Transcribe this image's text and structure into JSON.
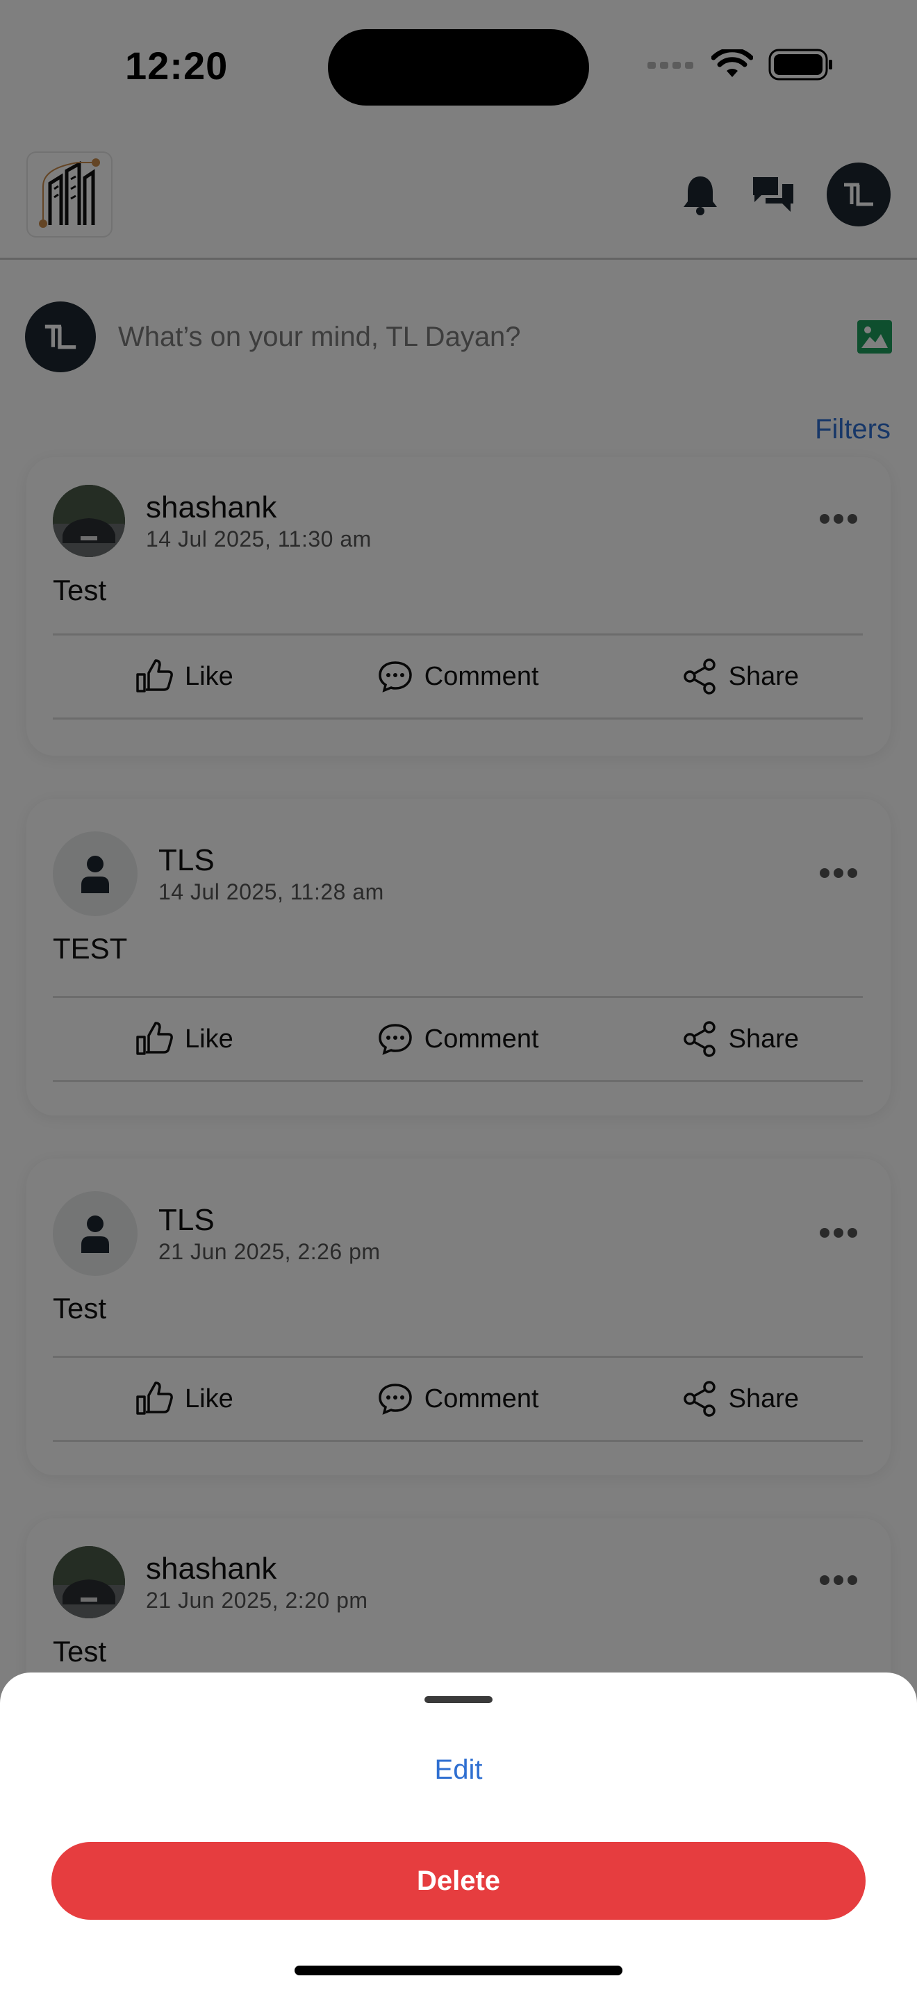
{
  "status_bar": {
    "time": "12:20"
  },
  "header": {
    "logo": "building-logo-icon",
    "avatar_initials": "TL"
  },
  "composer": {
    "avatar_initials": "TL",
    "placeholder": "What’s on your mind, TL Dayan?"
  },
  "filters_label": "Filters",
  "posts": [
    {
      "author": "shashank",
      "date": "14 Jul 2025, 11:30 am",
      "body": "Test",
      "avatar": "car-photo"
    },
    {
      "author": "TLS",
      "date": "14 Jul 2025, 11:28 am",
      "body": "TEST",
      "avatar": "person-icon"
    },
    {
      "author": "TLS",
      "date": "21 Jun 2025, 2:26 pm",
      "body": "Test",
      "avatar": "person-icon"
    },
    {
      "author": "shashank",
      "date": "21 Jun 2025, 2:20 pm",
      "body": "Test",
      "avatar": "car-photo"
    }
  ],
  "actions": {
    "like": "Like",
    "comment": "Comment",
    "share": "Share"
  },
  "sheet": {
    "edit_label": "Edit",
    "delete_label": "Delete"
  },
  "colors": {
    "accent": "#2f6fd1",
    "danger": "#e63d3f",
    "avatar_bg": "#1d2730"
  }
}
